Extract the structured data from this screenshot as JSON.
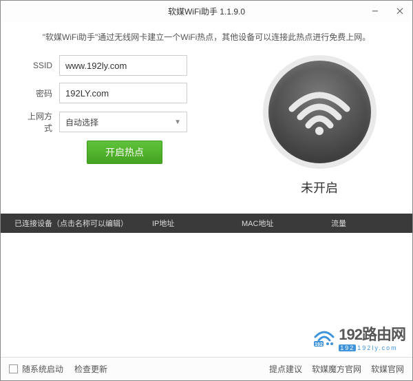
{
  "titlebar": {
    "title": "软媒WiFi助手 1.1.9.0"
  },
  "subtitle": "\"软媒WiFi助手\"通过无线网卡建立一个WiFi热点，其他设备可以连接此热点进行免费上网。",
  "form": {
    "ssid_label": "SSID",
    "ssid_value": "www.192ly.com",
    "password_label": "密码",
    "password_value": "192LY.com",
    "conn_label": "上网方式",
    "conn_value": "自动选择",
    "start_button": "开启热点"
  },
  "status": {
    "text": "未开启"
  },
  "table": {
    "headers": {
      "device": "已连接设备（点击名称可以编辑）",
      "ip": "IP地址",
      "mac": "MAC地址",
      "traffic": "流量"
    }
  },
  "footer": {
    "autostart": "随系统启动",
    "check_update": "检查更新",
    "links": {
      "suggest": "提点建议",
      "mofang": "软媒魔方官网",
      "ruanmei": "软媒官网"
    }
  },
  "watermark": {
    "brand_num": "192",
    "brand_text": "路由网",
    "url": "192ly.com"
  }
}
